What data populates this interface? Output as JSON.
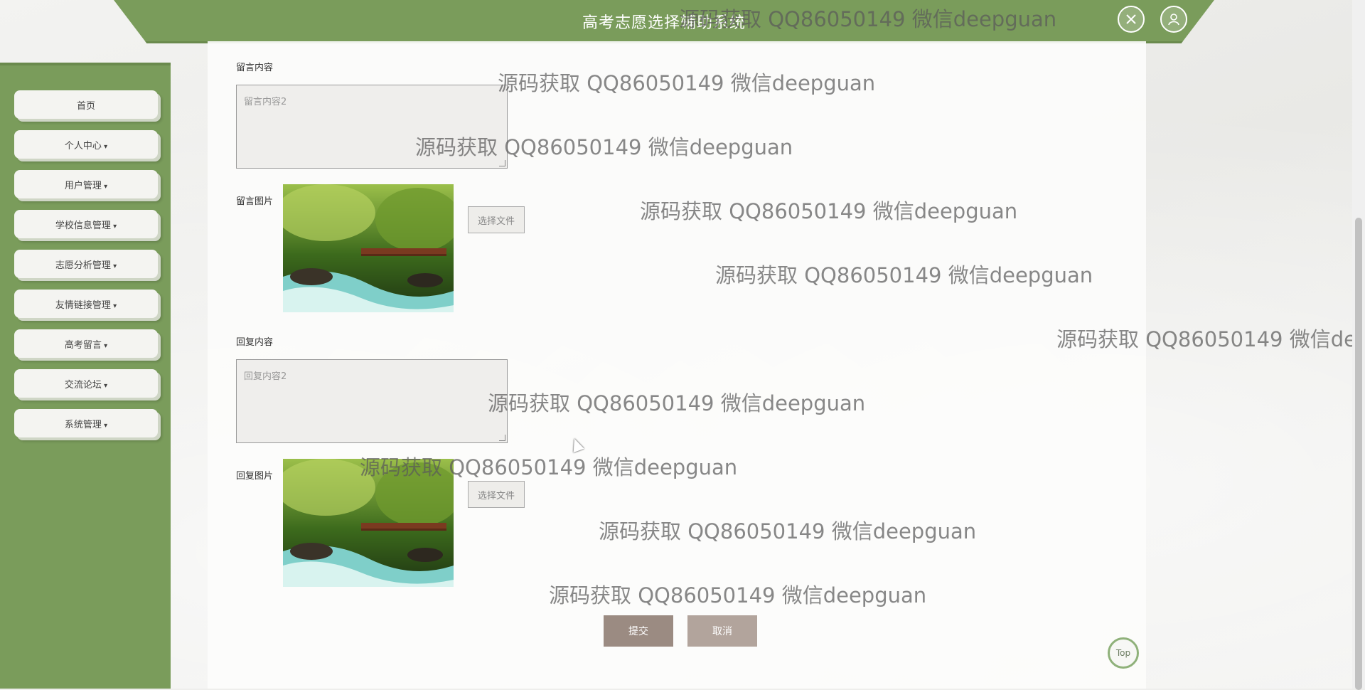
{
  "app": {
    "title": "高考志愿选择辅助系统"
  },
  "header_icons": {
    "fullscreen_icon": "expand-icon",
    "user_icon": "user-icon"
  },
  "sidebar": {
    "items": [
      {
        "label": "首页",
        "has_caret": false
      },
      {
        "label": "个人中心",
        "has_caret": true
      },
      {
        "label": "用户管理",
        "has_caret": true
      },
      {
        "label": "学校信息管理",
        "has_caret": true
      },
      {
        "label": "志愿分析管理",
        "has_caret": true
      },
      {
        "label": "友情链接管理",
        "has_caret": true
      },
      {
        "label": "高考留言",
        "has_caret": true
      },
      {
        "label": "交流论坛",
        "has_caret": true
      },
      {
        "label": "系统管理",
        "has_caret": true
      }
    ]
  },
  "form": {
    "message_content_label": "留言内容",
    "message_content_value": "留言内容2",
    "message_image_label": "留言图片",
    "reply_content_label": "回复内容",
    "reply_content_value": "回复内容2",
    "reply_image_label": "回复图片",
    "choose_file_label": "选择文件",
    "submit_label": "提交",
    "cancel_label": "取消"
  },
  "back_to_top": "Top",
  "watermark_text": "源码获取 QQ86050149 微信deepguan",
  "colors": {
    "brand_green": "#7a9c5b",
    "submit": "#9b8b82",
    "cancel": "#b2a49c"
  }
}
